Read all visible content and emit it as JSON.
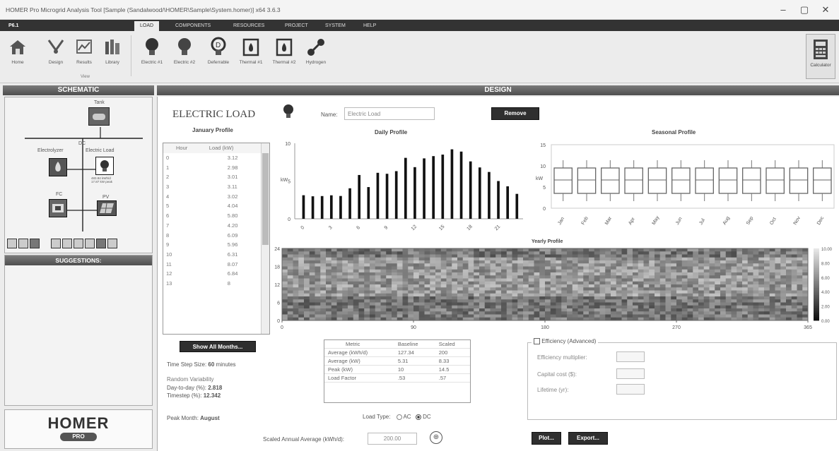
{
  "window": {
    "title": "HOMER Pro Microgrid Analysis Tool [Sample (Sandalwood/\\HOMER\\Sample\\System.homer)] x64 3.6.3",
    "controls": [
      "–",
      "▢",
      "✕"
    ]
  },
  "ribbon": {
    "app_tab": "P6.1",
    "tabs": [
      "LOAD",
      "COMPONENTS",
      "RESOURCES",
      "PROJECT",
      "SYSTEM",
      "HELP"
    ],
    "home_buttons": [
      {
        "label": "Home",
        "icon": "home-icon"
      },
      {
        "label": "Design",
        "icon": "design-icon"
      },
      {
        "label": "Results",
        "icon": "results-icon"
      },
      {
        "label": "Library",
        "icon": "library-icon"
      }
    ],
    "view_group_label": "View",
    "load_buttons": [
      {
        "label": "Electric #1",
        "icon": "bulb-icon"
      },
      {
        "label": "Electric #2",
        "icon": "bulb-icon"
      },
      {
        "label": "Deferrable",
        "icon": "deferrable-icon"
      },
      {
        "label": "Thermal #1",
        "icon": "flame-icon"
      },
      {
        "label": "Thermal #2",
        "icon": "flame-icon"
      },
      {
        "label": "Hydrogen",
        "icon": "hydrogen-icon"
      }
    ],
    "calculator_label": "Calculator"
  },
  "schematic": {
    "header": "SCHEMATIC",
    "tank_label": "Tank",
    "dc_label": "DC",
    "electrolyzer_label": "Electrolyzer",
    "electric_load_label": "Electric Load",
    "load_note": "483.84 kWh/d\n17.87 kW peak",
    "fc_label": "FC",
    "pv_label": "PV"
  },
  "suggestions": {
    "header": "SUGGESTIONS:"
  },
  "logo": {
    "text": "HOMER",
    "sub": "PRO"
  },
  "design": {
    "header": "DESIGN",
    "title": "ELECTRIC LOAD",
    "name_label": "Name:",
    "name_value": "Electric Load",
    "remove_label": "Remove"
  },
  "january": {
    "title": "January Profile",
    "col_hour": "Hour",
    "col_load": "Load (kW)",
    "rows": [
      [
        "0",
        "3.12"
      ],
      [
        "1",
        "2.98"
      ],
      [
        "2",
        "3.01"
      ],
      [
        "3",
        "3.11"
      ],
      [
        "4",
        "3.02"
      ],
      [
        "5",
        "4.04"
      ],
      [
        "6",
        "5.80"
      ],
      [
        "7",
        "4.20"
      ],
      [
        "8",
        "6.09"
      ],
      [
        "9",
        "5.96"
      ],
      [
        "10",
        "6.31"
      ],
      [
        "11",
        "8.07"
      ],
      [
        "12",
        "6.84"
      ],
      [
        "13",
        "8"
      ]
    ]
  },
  "daily": {
    "title": "Daily Profile",
    "ylabel": "kW",
    "yticks": [
      "10",
      "5",
      "0"
    ],
    "xticks": [
      "0",
      "3",
      "6",
      "9",
      "12",
      "15",
      "18",
      "21"
    ],
    "ymax": 10,
    "values": [
      3.12,
      2.98,
      3.01,
      3.11,
      3.02,
      4.04,
      5.8,
      4.2,
      6.09,
      5.96,
      6.31,
      8.07,
      6.84,
      8,
      8.3,
      8.5,
      9.2,
      8.9,
      7.6,
      6.8,
      6.2,
      5.0,
      4.3,
      3.3
    ]
  },
  "seasonal": {
    "title": "Seasonal Profile",
    "ylabel": "kW",
    "yticks": [
      "15",
      "10",
      "5",
      "0"
    ],
    "months": [
      "Jan",
      "Feb",
      "Mar",
      "Apr",
      "May",
      "Jun",
      "Jul",
      "Aug",
      "Sep",
      "Oct",
      "Nov",
      "Dec"
    ]
  },
  "yearly": {
    "title": "Yearly Profile",
    "yticks": [
      "24",
      "18",
      "12",
      "6",
      "0"
    ],
    "xticks": [
      "0",
      "90",
      "180",
      "270",
      "365"
    ],
    "scale": [
      "10.00",
      "8.00",
      "6.00",
      "4.00",
      "2.00",
      "0.00"
    ]
  },
  "controls": {
    "show_all": "Show All Months...",
    "timestep_prefix": "Time Step Size:",
    "timestep_value": "60",
    "timestep_unit": "minutes",
    "variability_label": "Random Variability",
    "day_label": "Day-to-day (%):",
    "day_value": "2.818",
    "ts_label": "Timestep (%):",
    "ts_value": "12.342",
    "peak_label": "Peak Month:",
    "peak_value": "August"
  },
  "metrics": {
    "headers": [
      "Metric",
      "Baseline",
      "Scaled"
    ],
    "rows": [
      [
        "Average (kWh/d)",
        "127.34",
        "200"
      ],
      [
        "Average (kW)",
        "5.31",
        "8.33"
      ],
      [
        "Peak (kW)",
        "10",
        "14.5"
      ],
      [
        "Load Factor",
        ".53",
        ".57"
      ]
    ]
  },
  "load_type": {
    "label": "Load Type:",
    "ac": "AC",
    "dc": "DC"
  },
  "scaled": {
    "label": "Scaled Annual Average (kWh/d):",
    "value": "200.00"
  },
  "efficiency": {
    "check_label": "Efficiency (Advanced)",
    "multiplier_label": "Efficiency multiplier:",
    "capital_label": "Capital cost ($):",
    "lifetime_label": "Lifetime (yr):"
  },
  "buttons": {
    "plot": "Plot...",
    "export": "Export..."
  },
  "colors": {
    "accent": "#1e1e1e",
    "bar": "#111111",
    "header": "#555555"
  }
}
